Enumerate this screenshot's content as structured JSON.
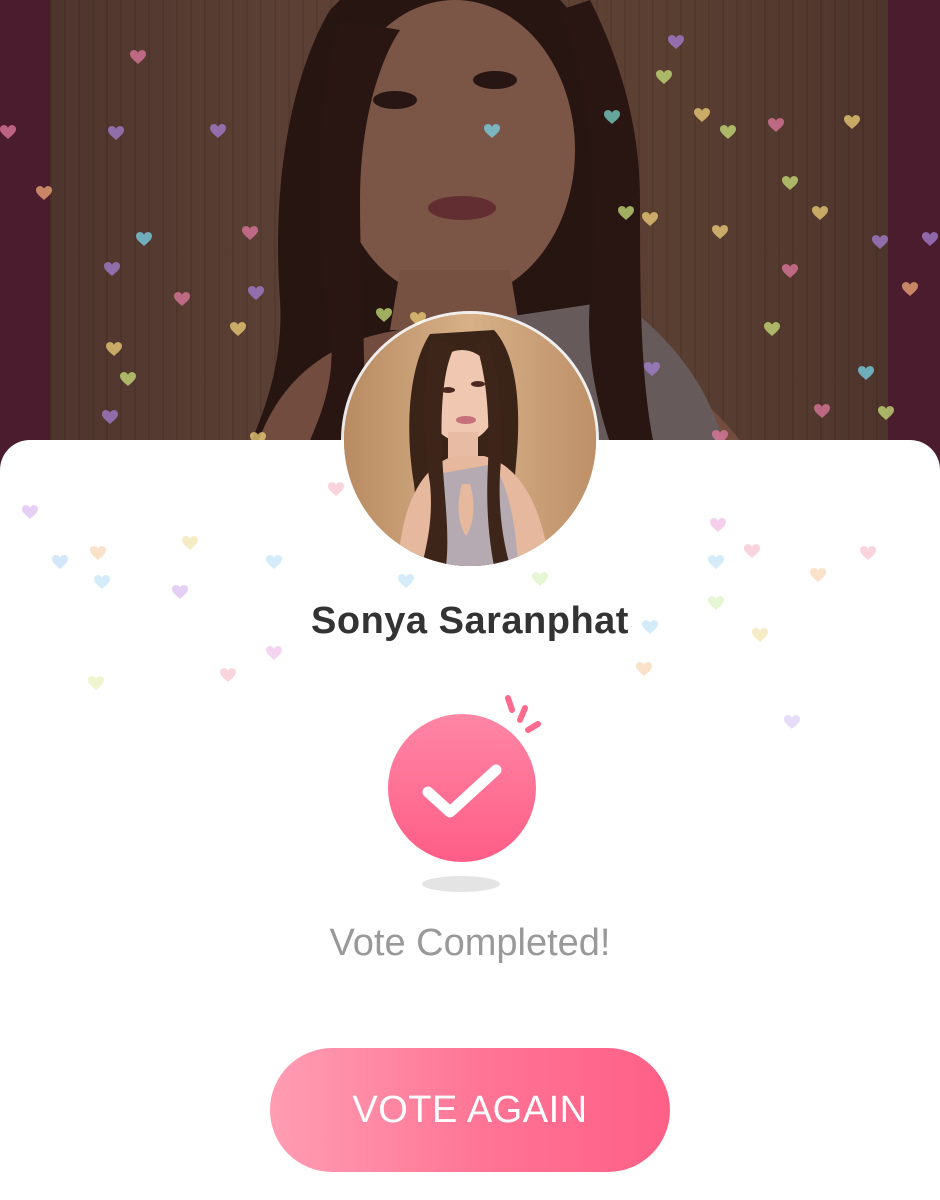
{
  "contestant": {
    "name": "Sonya Saranphat",
    "photo_icon": "profile-photo"
  },
  "result": {
    "icon": "checkmark-icon",
    "status_text": "Vote Completed!"
  },
  "actions": {
    "vote_again_label": "VOTE AGAIN"
  },
  "colors": {
    "accent": "#ff6a8f",
    "accent_light": "#ff9db3",
    "name_text": "#333333",
    "status_text": "#999999",
    "backdrop": "#5a2238"
  }
}
